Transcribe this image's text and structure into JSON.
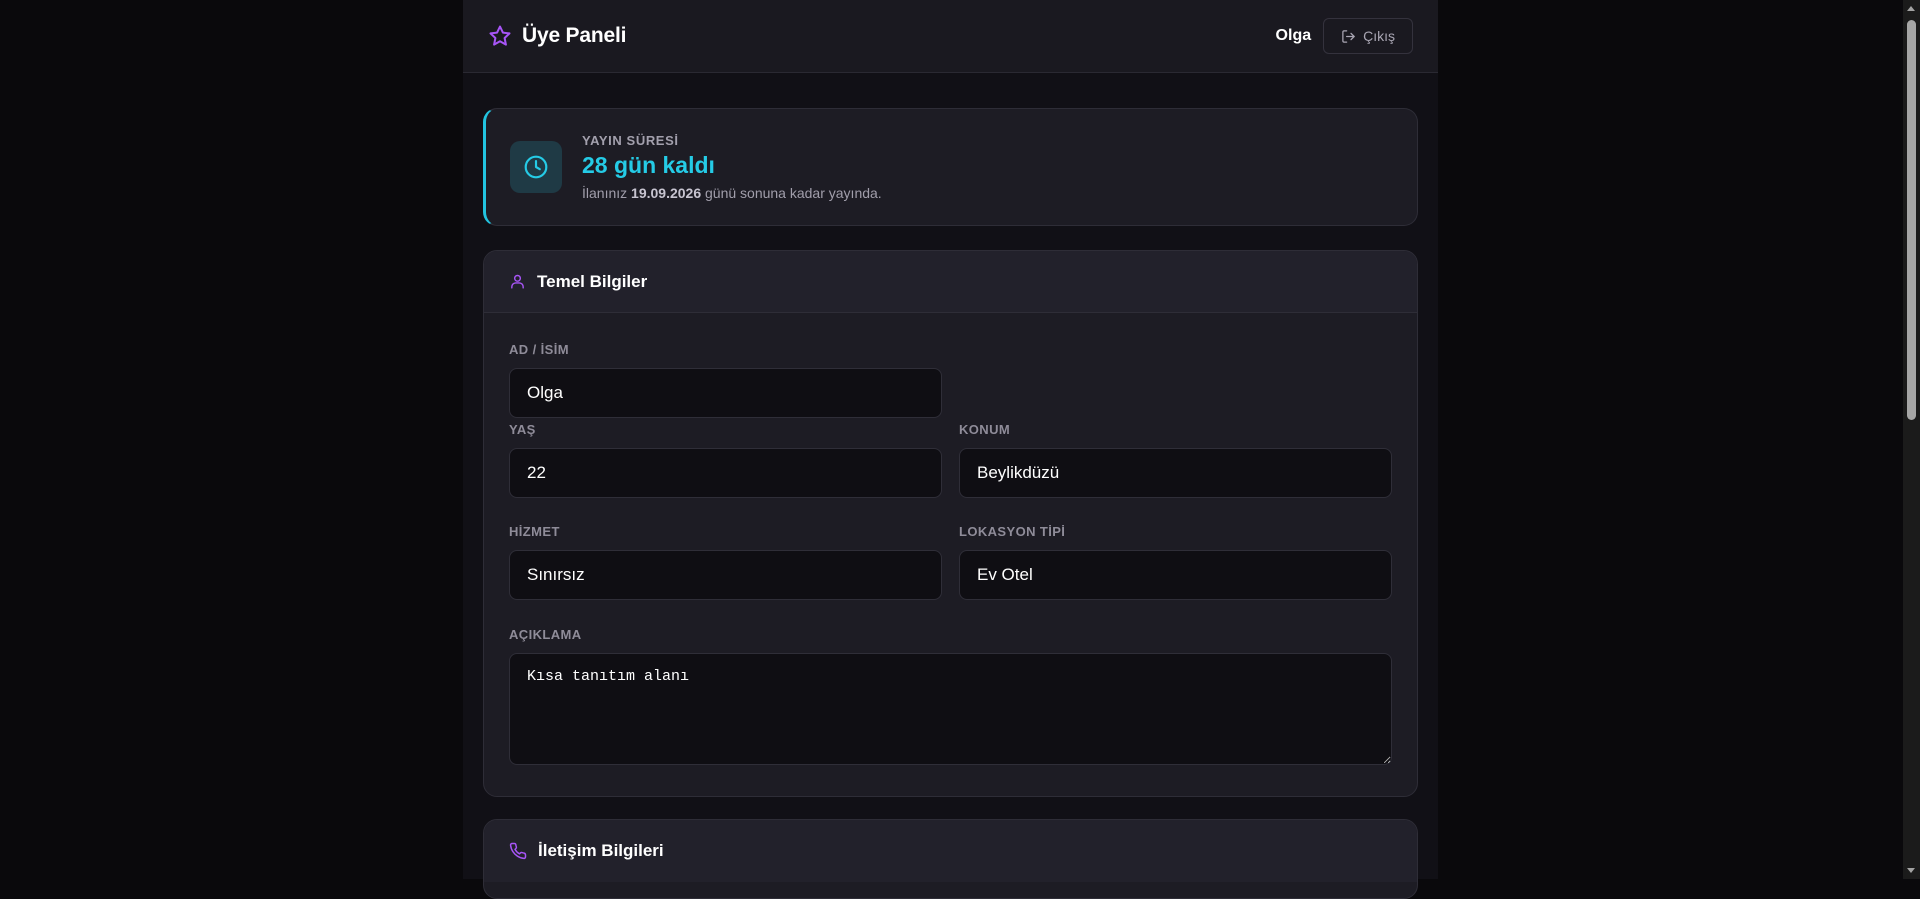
{
  "header": {
    "title": "Üye Paneli",
    "user_name": "Olga",
    "logout_label": "Çıkış"
  },
  "publish": {
    "label": "YAYIN SÜRESİ",
    "remaining": "28 gün kaldı",
    "desc_prefix": "İlanınız",
    "date": "19.09.2026",
    "desc_suffix": "günü sonuna kadar yayında."
  },
  "basic_info": {
    "title": "Temel Bilgiler",
    "fields": {
      "name": {
        "label": "AD / İSİM",
        "value": "Olga"
      },
      "age": {
        "label": "YAŞ",
        "value": "22"
      },
      "location": {
        "label": "KONUM",
        "value": "Beylikdüzü"
      },
      "service": {
        "label": "HİZMET",
        "value": "Sınırsız"
      },
      "location_type": {
        "label": "LOKASYON TİPİ",
        "value": "Ev Otel"
      },
      "description": {
        "label": "AÇIKLAMA",
        "value": "Kısa tanıtım alanı"
      }
    }
  },
  "contact_info": {
    "title": "İletişim Bilgileri"
  },
  "colors": {
    "accent_purple": "#a855f7",
    "accent_cyan": "#22c4e0",
    "background": "#0a090c",
    "panel": "#1d1c24"
  },
  "icons": {
    "brand": "star-icon",
    "logout": "logout-icon",
    "time": "clock-icon",
    "basic": "user-icon",
    "contact": "phone-icon"
  }
}
